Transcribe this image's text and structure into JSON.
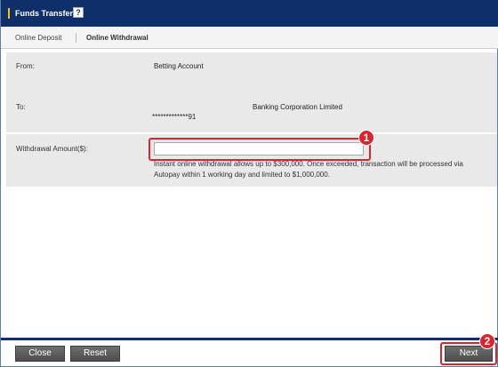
{
  "window": {
    "title": "Funds Transfer",
    "help_icon": "?"
  },
  "tabs": [
    {
      "label": "Online Deposit",
      "active": false
    },
    {
      "label": "Online Withdrawal",
      "active": true
    }
  ],
  "form": {
    "from_label": "From:",
    "from_value": "Betting Account",
    "to_label": "To:",
    "to_bank": "Banking Corporation Limited",
    "to_account": "*************91",
    "amount_label": "Withdrawal Amount($):",
    "amount_value": "",
    "amount_placeholder": "",
    "note": "Instant online withdrawal allows up to $300,000. Once exceeded, transaction will be processed via Autopay within 1 working day and limited to $1,000,000."
  },
  "markers": {
    "step1": "1",
    "step2": "2"
  },
  "buttons": {
    "close": "Close",
    "reset": "Reset",
    "next": "Next"
  },
  "colors": {
    "header_navy": "#0f2f6b",
    "title_accent": "#f2c200",
    "highlight_red": "#d6262e",
    "form_band": "#e9e9e9",
    "button_gray": "#5a5a5a"
  }
}
